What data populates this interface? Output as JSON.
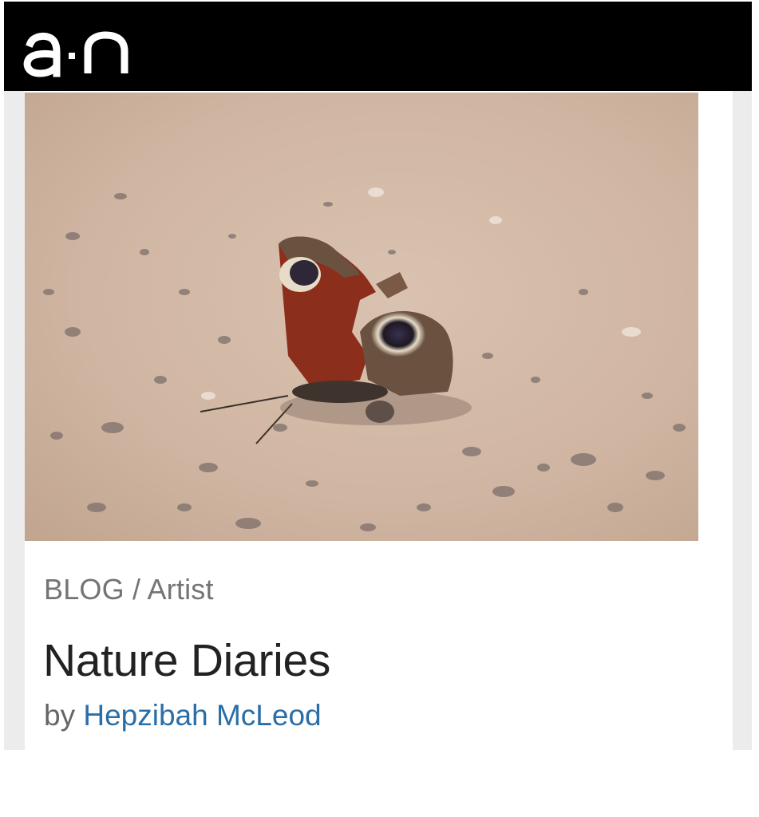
{
  "header": {
    "logo_text": "a·n",
    "background": "#000000"
  },
  "hero": {
    "subject": "butterfly-on-gravel-photo"
  },
  "post": {
    "category_prefix": "BLOG",
    "separator": "/",
    "category": "Artist",
    "title": "Nature Diaries",
    "byline_prefix": "by",
    "author": "Hepzibah McLeod"
  },
  "colors": {
    "link": "#2a6ea8",
    "category_text": "#747474",
    "title_text": "#222222",
    "frame_background": "#ececec"
  }
}
